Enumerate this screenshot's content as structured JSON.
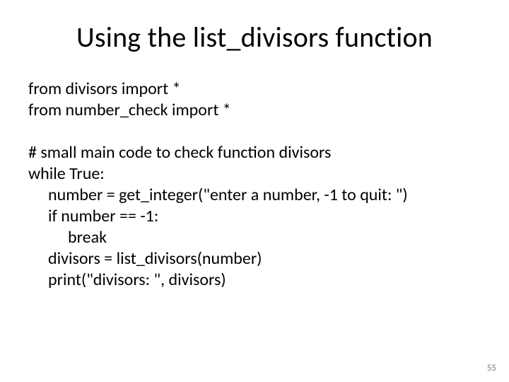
{
  "title": "Using the list_divisors function",
  "code": {
    "l1": "from divisors import *",
    "l2": "from number_check import *",
    "l3": "# small main code to check function divisors",
    "l4": "while True:",
    "l5": "number = get_integer(\"enter a number, -1 to quit: \")",
    "l6": "if number == -1:",
    "l7": "break",
    "l8": "divisors = list_divisors(number)",
    "l9": "print(\"divisors: \", divisors)"
  },
  "page_number": "55"
}
